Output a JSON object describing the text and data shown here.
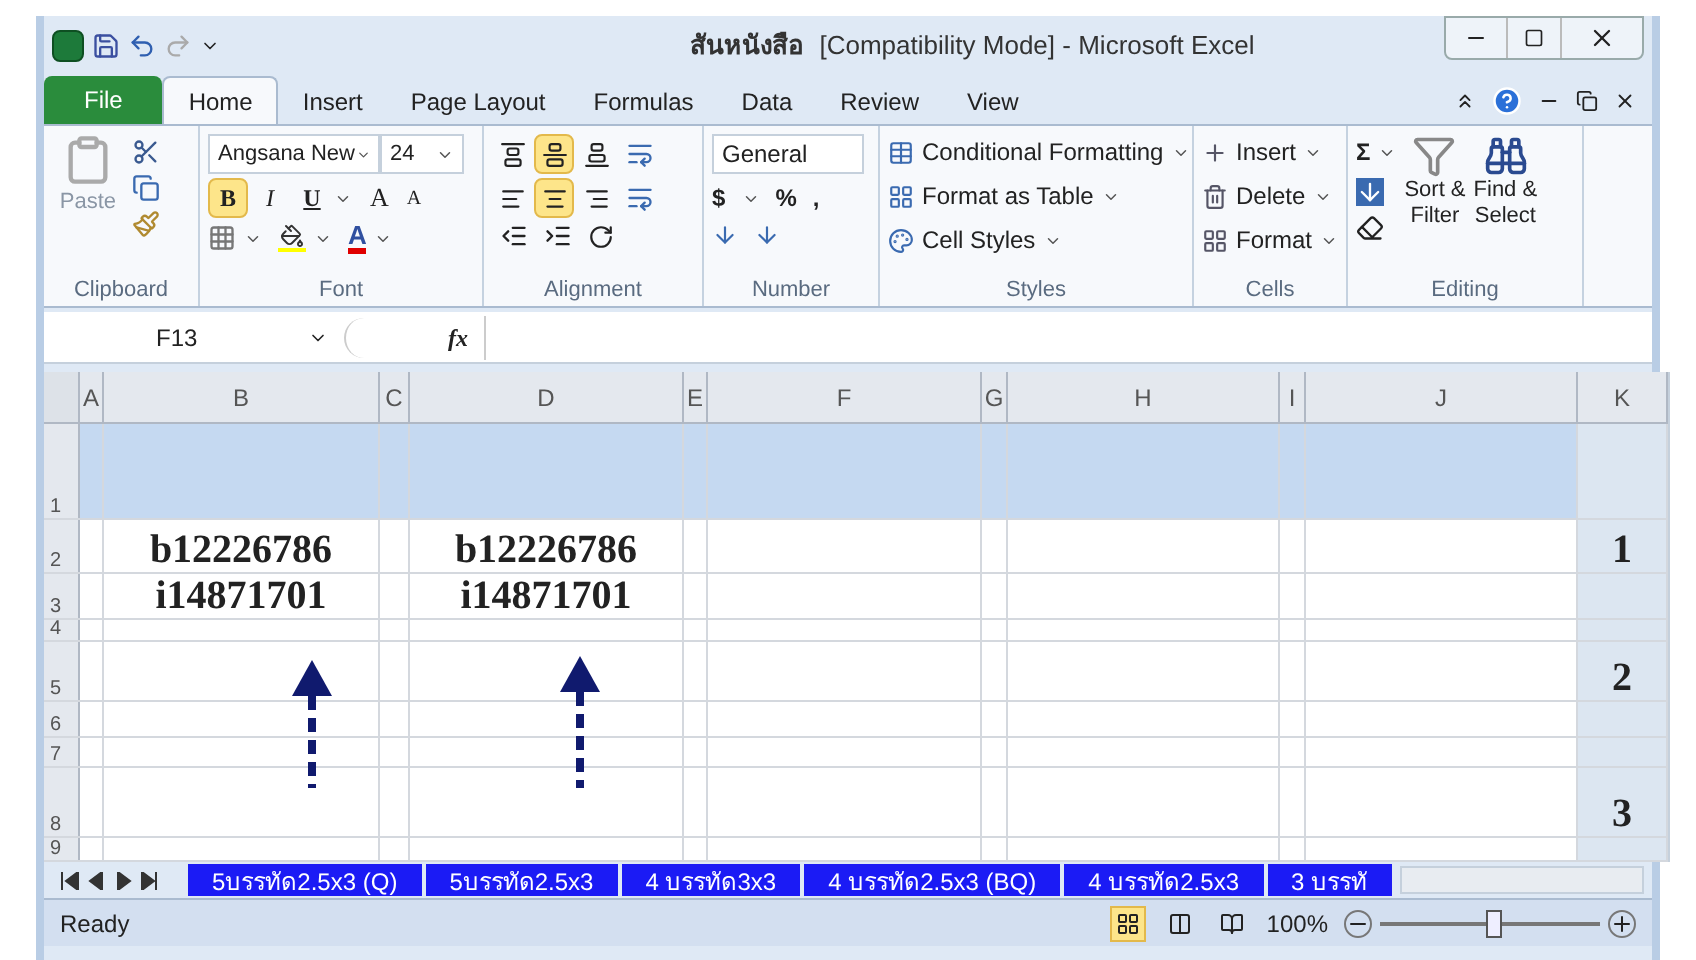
{
  "window": {
    "doc_name": "สันหนังสือ",
    "mode": "[Compatibility Mode]",
    "app": "- Microsoft Excel"
  },
  "ribbon_tabs": [
    {
      "label": "File",
      "kind": "file",
      "selected": false
    },
    {
      "label": "Home",
      "kind": "tab",
      "selected": true
    },
    {
      "label": "Insert",
      "kind": "tab",
      "selected": false
    },
    {
      "label": "Page Layout",
      "kind": "tab",
      "selected": false
    },
    {
      "label": "Formulas",
      "kind": "tab",
      "selected": false
    },
    {
      "label": "Data",
      "kind": "tab",
      "selected": false
    },
    {
      "label": "Review",
      "kind": "tab",
      "selected": false
    },
    {
      "label": "View",
      "kind": "tab",
      "selected": false
    }
  ],
  "clipboard": {
    "paste": "Paste",
    "label": "Clipboard"
  },
  "font": {
    "name": "Angsana New",
    "size": "24",
    "bold": "B",
    "italic": "I",
    "underline": "U",
    "grow": "A",
    "shrink": "A",
    "color_letter": "A",
    "bold_on": true,
    "italic_on": false,
    "underline_on": false,
    "label": "Font"
  },
  "alignment": {
    "top_row": [
      {
        "on": false
      },
      {
        "on": true
      },
      {
        "on": false
      }
    ],
    "mid_row": [
      {
        "on": false
      },
      {
        "on": true
      },
      {
        "on": false
      }
    ],
    "label": "Alignment"
  },
  "number": {
    "format": "General",
    "currency": "$",
    "percent": "%",
    "comma": ",",
    "label": "Number"
  },
  "styles": {
    "items": [
      "Conditional Formatting",
      "Format as Table",
      "Cell Styles"
    ],
    "label": "Styles"
  },
  "cells": {
    "items": [
      "Insert",
      "Delete",
      "Format"
    ],
    "label": "Cells"
  },
  "editing": {
    "sum": "Σ",
    "sort": [
      "Sort &",
      "Filter"
    ],
    "find": [
      "Find &",
      "Select"
    ],
    "label": "Editing"
  },
  "formula_bar": {
    "name_box": "F13",
    "fx": "fx"
  },
  "columns": [
    {
      "label": "A",
      "shaded": false
    },
    {
      "label": "B",
      "shaded": false
    },
    {
      "label": "C",
      "shaded": false
    },
    {
      "label": "D",
      "shaded": false
    },
    {
      "label": "E",
      "shaded": false
    },
    {
      "label": "F",
      "shaded": false
    },
    {
      "label": "G",
      "shaded": false
    },
    {
      "label": "H",
      "shaded": false
    },
    {
      "label": "I",
      "shaded": false
    },
    {
      "label": "J",
      "shaded": false
    },
    {
      "label": "K",
      "shaded": true
    }
  ],
  "rows": [
    {
      "header": "1",
      "shaded": true
    },
    {
      "header": "2",
      "shaded": false,
      "values": {
        "B": "b12226786",
        "D": "b12226786",
        "K": "1"
      }
    },
    {
      "header": "3",
      "shaded": false,
      "values": {
        "B": "i14871701",
        "D": "i14871701"
      }
    },
    {
      "header": "4",
      "shaded": false
    },
    {
      "header": "5",
      "shaded": false,
      "values": {
        "K": "2"
      }
    },
    {
      "header": "6",
      "shaded": false
    },
    {
      "header": "7",
      "shaded": false
    },
    {
      "header": "8",
      "shaded": false,
      "values": {
        "K": "3"
      }
    },
    {
      "header": "9",
      "shaded": false
    }
  ],
  "sheet_tabs": [
    {
      "label": "5บรรทัด2.5x3 (Q)",
      "selected": false
    },
    {
      "label": "5บรรทัด2.5x3",
      "selected": false
    },
    {
      "label": "4 บรรทัด3x3",
      "selected": false
    },
    {
      "label": "4 บรรทัด2.5x3  (BQ)",
      "selected": false
    },
    {
      "label": "4 บรรทัด2.5x3",
      "selected": false
    },
    {
      "label": "3 บรรทั",
      "selected": false
    }
  ],
  "status_bar": {
    "status": "Ready",
    "views": [
      {
        "selected": true
      },
      {
        "selected": false
      },
      {
        "selected": false
      }
    ],
    "zoom": "100%",
    "zoom_slider": {
      "level": 0.52
    }
  }
}
